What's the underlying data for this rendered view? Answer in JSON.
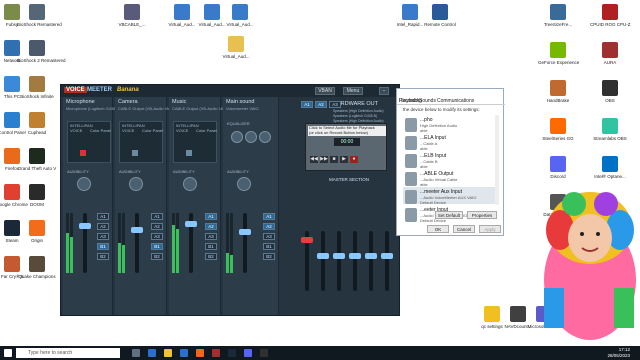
{
  "desktop": {
    "left_icons": [
      {
        "label": "Fubsy",
        "color": "#7a8b4a"
      },
      {
        "label": "BioShock Remastered",
        "color": "#556677"
      },
      {
        "label": "Network",
        "color": "#2f6fb2"
      },
      {
        "label": "BioShock 2 Remastered",
        "color": "#4a5a6a"
      },
      {
        "label": "This PC",
        "color": "#3b8ad8"
      },
      {
        "label": "BioShock Infinite",
        "color": "#a37a40"
      },
      {
        "label": "Control Panel",
        "color": "#2a7fcf"
      },
      {
        "label": "Cuphead",
        "color": "#c08030"
      },
      {
        "label": "Firefox",
        "color": "#e86a1a"
      },
      {
        "label": "Grand Theft Auto V",
        "color": "#1f2a1f"
      },
      {
        "label": "Google Chrome",
        "color": "#e04030"
      },
      {
        "label": "DOOM",
        "color": "#2a2a2a"
      },
      {
        "label": "Steam",
        "color": "#1b2838"
      },
      {
        "label": "Origin",
        "color": "#f26c1a"
      },
      {
        "label": "Far Cry® 5",
        "color": "#c45a30"
      },
      {
        "label": "Quake Champions",
        "color": "#5a4a3a"
      }
    ],
    "top_icons": [
      {
        "label": "VBCABLE_...",
        "color": "#5a5a7a"
      },
      {
        "label": "Virtual_Aud...",
        "color": "#3a7acb"
      },
      {
        "label": "Virtual_Aud...",
        "color": "#3a7acb"
      },
      {
        "label": "Virtual_Aud...",
        "color": "#3a7acb"
      },
      {
        "label": "Virtual_Aud...",
        "color": "#e8c050"
      },
      {
        "label": "Intel_Rapid...",
        "color": "#3a7acb"
      },
      {
        "label": "Remote Control",
        "color": "#2a5a9a"
      }
    ],
    "right_icons": [
      {
        "label": "TreeSizeFre...",
        "color": "#3a6a9a"
      },
      {
        "label": "CPUID ROG CPU-Z",
        "color": "#b02020"
      },
      {
        "label": "GeForce Experience",
        "color": "#76b900"
      },
      {
        "label": "AURA",
        "color": "#a03030"
      },
      {
        "label": "HandBrake",
        "color": "#c06a30"
      },
      {
        "label": "OBS",
        "color": "#303030"
      },
      {
        "label": "SteelSeries GG",
        "color": "#ff6a00"
      },
      {
        "label": "Streamlabs OBS",
        "color": "#31c3a2"
      },
      {
        "label": "Discord",
        "color": "#5865f2"
      },
      {
        "label": "Intel® Optane...",
        "color": "#0071c5"
      },
      {
        "label": "Data Migration",
        "color": "#555"
      },
      {
        "label": "Recycle Bin",
        "color": "#8aa0b0"
      }
    ],
    "bottom_icons": [
      {
        "label": "qc settings",
        "color": "#f0c020"
      },
      {
        "label": "NAVDcount...",
        "color": "#404040"
      },
      {
        "label": "Microsoft Teams",
        "color": "#5a5ac8"
      }
    ]
  },
  "voicemeeter": {
    "logo": "VOICE",
    "logo2": "MEETER",
    "logo3": "Banana",
    "btn_vban": "VBAN",
    "btn_menu": "Menu",
    "strips": [
      {
        "name": "Microphone",
        "sub": "Microphone (Logitech G435 B"
      },
      {
        "name": "Camera",
        "sub": "CABLE Output (VB-Audio Vir"
      },
      {
        "name": "Music",
        "sub": "CABLE Output (VB-Audio 16)"
      },
      {
        "name": "Main sound",
        "sub": "Voicemeeter VAIO"
      }
    ],
    "intellipan": "INTELLIPAN",
    "voice": "VOICE",
    "color_panel": "Color Panel",
    "audibility": "AUDIBILITY",
    "equalizer": "EQUALIZER",
    "hardware_out": "HARDWARE OUT",
    "hw_a1": "Speakers (High Definition Audio)",
    "hw_a2": "Speakers (Logitech G435 B)",
    "hw_a3": "Speakers (High Definition Audio)",
    "master_section": "MASTER SECTION",
    "bus_labels": [
      "A1",
      "A2",
      "A3",
      "B1",
      "B2"
    ],
    "tape_msg1": "Click to Select Audio file for Playback",
    "tape_msg2": "(or click on Record Button below)",
    "tape_time": "00:00",
    "fader_label": "Fader Gain",
    "mono": "MONO",
    "solo": "SOLO",
    "mute": "Mute"
  },
  "sound_dialog": {
    "tab_playback": "Playback",
    "tab_recording": "Recording",
    "tab_sounds": "Sounds",
    "tab_communications": "Communications",
    "desc": "the device below to modify its settings:",
    "devices": [
      {
        "name": "...pho",
        "desc": "High Definition Audio",
        "status": "able"
      },
      {
        "name": "...ELA Input",
        "desc": "...Cable A",
        "status": "able"
      },
      {
        "name": "...ELB Input",
        "desc": "...Cable B",
        "status": "able"
      },
      {
        "name": "...ABLE Output",
        "desc": "...Audio Virtual Cable",
        "status": "able"
      },
      {
        "name": "...meeter Aux Input",
        "desc": "...Audio VoiceMeeter AUX VAIO",
        "status": "Default Device"
      },
      {
        "name": "...eeter Input",
        "desc": "...Audio VoiceMeeter VAIO",
        "status": "Default Device"
      }
    ],
    "btn_set_default": "Set Default",
    "btn_properties": "Properties",
    "btn_ok": "OK",
    "btn_cancel": "Cancel",
    "btn_apply": "Apply"
  },
  "taskbar": {
    "search_placeholder": "Type here to search",
    "time": "17:12",
    "date": "28/05/2023"
  },
  "colors": {
    "vm_bg": "#263440",
    "accent": "#88c8ff",
    "taskbar": "#101820"
  }
}
